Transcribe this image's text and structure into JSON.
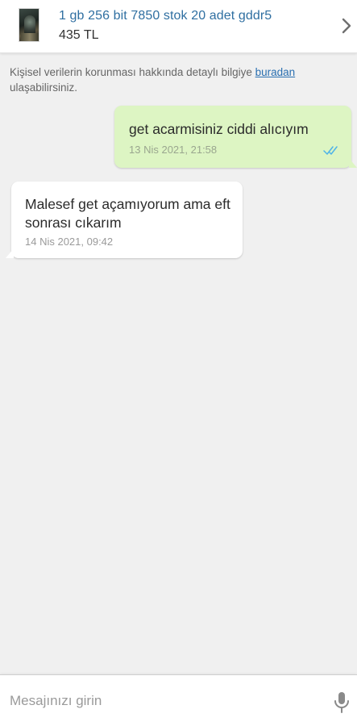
{
  "listing": {
    "title": "1 gb 256 bit 7850 stok 20 adet gddr5",
    "price": "435 TL"
  },
  "privacy": {
    "text_before_link": "Kişisel verilerin korunması hakkında detaylı bilgiye ",
    "link_label": "buradan",
    "text_after_link": " ulaşabilirsiniz."
  },
  "messages": [
    {
      "direction": "outgoing",
      "text": "get acarmisiniz ciddi alıcıyım",
      "time": "13 Nis 2021, 21:58",
      "status_icon": "double-check-icon"
    },
    {
      "direction": "incoming",
      "text": "Malesef get açamıyorum ama eft sonrası cıkarım",
      "time": "14 Nis 2021, 09:42"
    }
  ],
  "compose": {
    "placeholder": "Mesajınızı girin",
    "mic_icon": "microphone-icon"
  },
  "colors": {
    "accent": "#2f6fa1",
    "outgoing_bubble": "#ddf5c3",
    "incoming_bubble": "#ffffff",
    "read_ticks": "#4fb3e8",
    "background": "#f0f0f0"
  }
}
